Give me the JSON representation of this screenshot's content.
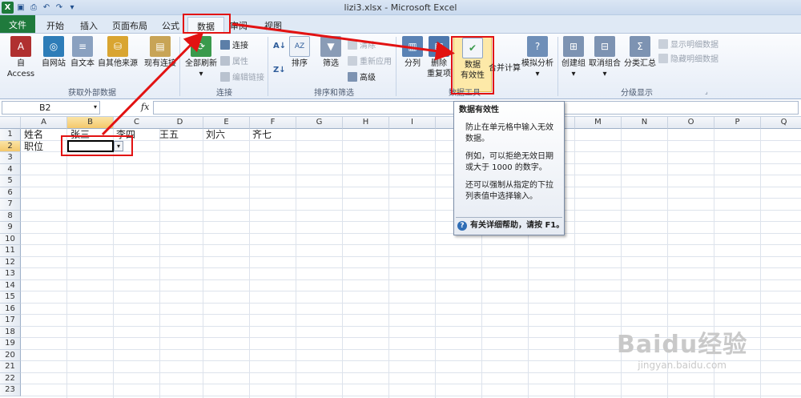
{
  "titlebar": {
    "title": "lizi3.xlsx - Microsoft Excel",
    "logo": "X",
    "save_icon": "save-icon",
    "undo_icon": "undo-icon"
  },
  "tabs": [
    "文件",
    "开始",
    "插入",
    "页面布局",
    "公式",
    "数据",
    "审阅",
    "视图"
  ],
  "active_tab": "数据",
  "ribbon": {
    "ext": {
      "label": "获取外部数据",
      "items": [
        "自 Access",
        "自网站",
        "自文本",
        "自其他来源",
        "现有连接"
      ]
    },
    "conn": {
      "label": "连接",
      "refresh": "全部刷新",
      "items": [
        "连接",
        "属性",
        "编辑链接"
      ]
    },
    "sort": {
      "label": "排序和筛选",
      "items": [
        "排序",
        "筛选"
      ],
      "clear": "清除",
      "reapply": "重新应用",
      "advanced": "高级"
    },
    "tools": {
      "label": "数据工具",
      "split": "分列",
      "dup1": "删除",
      "dup2": "重复项",
      "val1": "数据",
      "val2": "有效性",
      "merge": "合并计算",
      "whatif": "模拟分析"
    },
    "outline": {
      "label": "分级显示",
      "group": "创建组",
      "ungroup": "取消组合",
      "subtotal": "分类汇总",
      "show": "显示明细数据",
      "hide": "隐藏明细数据"
    }
  },
  "formula": {
    "namebox": "B2",
    "fx": "fx",
    "value": ""
  },
  "columns": [
    "A",
    "B",
    "C",
    "D",
    "E",
    "F",
    "G",
    "H",
    "I",
    "J",
    "K",
    "L",
    "M",
    "N",
    "O",
    "P",
    "Q"
  ],
  "rows": [
    "1",
    "2",
    "3",
    "4",
    "5",
    "6",
    "7",
    "8",
    "9",
    "10",
    "11",
    "12",
    "13",
    "14",
    "15",
    "16",
    "17",
    "18",
    "19",
    "20",
    "21",
    "22",
    "23"
  ],
  "cells": {
    "A1": "姓名",
    "B1": "张三",
    "C1": "李四",
    "D1": "王五",
    "E1": "刘六",
    "F1": "齐七",
    "A2": "职位"
  },
  "selected_cell": "B2",
  "tooltip": {
    "title": "数据有效性",
    "p1": "防止在单元格中输入无效数据。",
    "p2": "例如，可以拒绝无效日期或大于 1000 的数字。",
    "p3": "还可以强制从指定的下拉列表值中选择输入。",
    "help": "有关详细帮助，请按 F1。"
  },
  "watermark": {
    "brand": "Baidu经验",
    "url": "jingyan.baidu.com"
  },
  "colors": {
    "file_tab": "#1f7a3c",
    "annotation": "#e21212",
    "header_highlight": "#f4c86c"
  }
}
